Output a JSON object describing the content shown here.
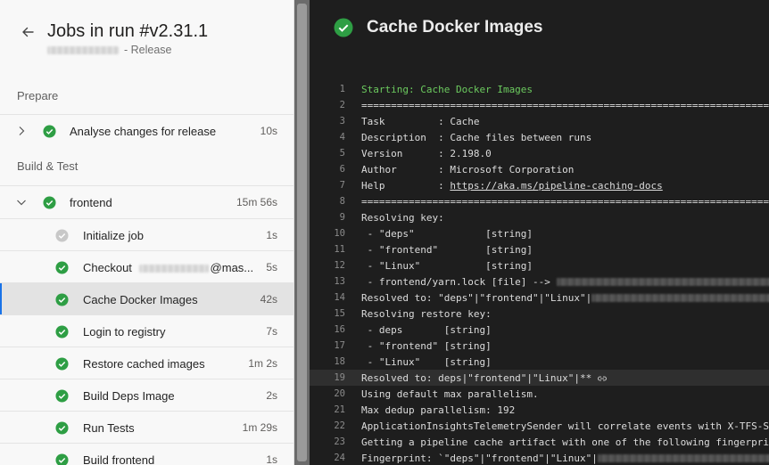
{
  "header": {
    "title": "Jobs in run #v2.31.1",
    "subtitle_suffix": "- Release"
  },
  "sections": {
    "prepare": "Prepare",
    "build_test": "Build & Test"
  },
  "jobs": {
    "analyse": {
      "label": "Analyse changes for release",
      "duration": "10s",
      "status": "succeeded"
    },
    "frontend": {
      "label": "frontend",
      "duration": "15m 56s",
      "status": "succeeded"
    }
  },
  "steps": [
    {
      "label": "Initialize job",
      "duration": "1s",
      "status": "skipped"
    },
    {
      "label": "Checkout",
      "label_suffix": "@mas...",
      "duration": "5s",
      "status": "succeeded"
    },
    {
      "label": "Cache Docker Images",
      "duration": "42s",
      "status": "succeeded",
      "selected": true
    },
    {
      "label": "Login to registry",
      "duration": "7s",
      "status": "succeeded"
    },
    {
      "label": "Restore cached images",
      "duration": "1m 2s",
      "status": "succeeded"
    },
    {
      "label": "Build Deps Image",
      "duration": "2s",
      "status": "succeeded"
    },
    {
      "label": "Run Tests",
      "duration": "1m 29s",
      "status": "succeeded"
    },
    {
      "label": "Build frontend",
      "duration": "1s",
      "status": "succeeded"
    }
  ],
  "task": {
    "title": "Cache Docker Images",
    "status": "succeeded"
  },
  "log": [
    {
      "n": "1",
      "text": "Starting: Cache Docker Images"
    },
    {
      "n": "2",
      "text": "================================================================================"
    },
    {
      "n": "3",
      "text": "Task         : Cache"
    },
    {
      "n": "4",
      "text": "Description  : Cache files between runs"
    },
    {
      "n": "5",
      "text": "Version      : 2.198.0"
    },
    {
      "n": "6",
      "text": "Author       : Microsoft Corporation"
    },
    {
      "n": "7",
      "text": "Help         : ",
      "link": "https://aka.ms/pipeline-caching-docs"
    },
    {
      "n": "8",
      "text": "================================================================================"
    },
    {
      "n": "9",
      "text": "Resolving key:"
    },
    {
      "n": "10",
      "text": " - \"deps\"            [string]"
    },
    {
      "n": "11",
      "text": " - \"frontend\"        [string]"
    },
    {
      "n": "12",
      "text": " - \"Linux\"           [string]"
    },
    {
      "n": "13",
      "text": " - frontend/yarn.lock [file] --> "
    },
    {
      "n": "14",
      "text": "Resolved to: \"deps\"|\"frontend\"|\"Linux\"|"
    },
    {
      "n": "15",
      "text": "Resolving restore key:"
    },
    {
      "n": "16",
      "text": " - deps       [string]"
    },
    {
      "n": "17",
      "text": " - \"frontend\" [string]"
    },
    {
      "n": "18",
      "text": " - \"Linux\"    [string]"
    },
    {
      "n": "19",
      "text": "Resolved to: deps|\"frontend\"|\"Linux\"|**"
    },
    {
      "n": "20",
      "text": "Using default max parallelism."
    },
    {
      "n": "21",
      "text": "Max dedup parallelism: 192"
    },
    {
      "n": "22",
      "text": "ApplicationInsightsTelemetrySender will correlate events with X-TFS-Session b"
    },
    {
      "n": "23",
      "text": "Getting a pipeline cache artifact with one of the following fingerprints:"
    },
    {
      "n": "24",
      "text": "Fingerprint: `\"deps\"|\"frontend\"|\"Linux\"|"
    }
  ],
  "colors": {
    "success": "#2e9e44",
    "skipped": "#c8c8c8",
    "log_green": "#6ccb5f",
    "selection_accent": "#1a73e8"
  },
  "icons": {
    "back": "arrow-left-icon",
    "expand": "chevron-right-icon",
    "collapse": "chevron-down-icon",
    "success": "check-circle-icon",
    "link": "link-icon"
  }
}
